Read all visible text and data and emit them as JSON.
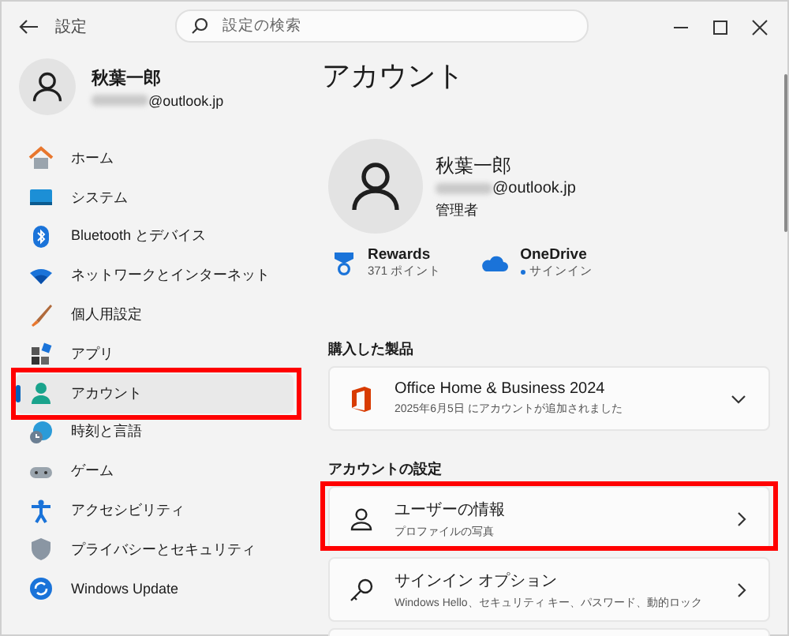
{
  "window": {
    "title": "設定"
  },
  "search": {
    "placeholder": "設定の検索"
  },
  "sidebar": {
    "profile": {
      "name": "秋葉一郎",
      "email": "@outlook.jp"
    },
    "items": [
      {
        "kind": "home",
        "label": "ホーム",
        "selected": false,
        "highlighted": false
      },
      {
        "kind": "system",
        "label": "システム",
        "selected": false,
        "highlighted": false
      },
      {
        "kind": "bluetooth",
        "label": "Bluetooth とデバイス",
        "selected": false,
        "highlighted": false
      },
      {
        "kind": "network",
        "label": "ネットワークとインターネット",
        "selected": false,
        "highlighted": false
      },
      {
        "kind": "personalization",
        "label": "個人用設定",
        "selected": false,
        "highlighted": false
      },
      {
        "kind": "apps",
        "label": "アプリ",
        "selected": false,
        "highlighted": false
      },
      {
        "kind": "accounts",
        "label": "アカウント",
        "selected": true,
        "highlighted": true
      },
      {
        "kind": "time",
        "label": "時刻と言語",
        "selected": false,
        "highlighted": false
      },
      {
        "kind": "gaming",
        "label": "ゲーム",
        "selected": false,
        "highlighted": false
      },
      {
        "kind": "accessibility",
        "label": "アクセシビリティ",
        "selected": false,
        "highlighted": false
      },
      {
        "kind": "privacy",
        "label": "プライバシーとセキュリティ",
        "selected": false,
        "highlighted": false
      },
      {
        "kind": "update",
        "label": "Windows Update",
        "selected": false,
        "highlighted": false
      }
    ]
  },
  "content": {
    "title": "アカウント",
    "profile": {
      "name": "秋葉一郎",
      "email": "@outlook.jp",
      "role": "管理者"
    },
    "services": [
      {
        "kind": "rewards",
        "name": "Rewards",
        "detail": "371 ポイント"
      },
      {
        "kind": "onedrive",
        "name": "OneDrive",
        "detail": "サインイン"
      }
    ],
    "sections": [
      {
        "heading": "購入した製品",
        "cards": [
          {
            "kind": "office",
            "title": "Office Home & Business 2024",
            "subtitle": "2025年6月5日 にアカウントが追加されました",
            "expandable": true,
            "highlighted": false
          }
        ]
      },
      {
        "heading": "アカウントの設定",
        "cards": [
          {
            "kind": "user",
            "title": "ユーザーの情報",
            "subtitle": "プロファイルの写真",
            "expandable": false,
            "highlighted": true
          },
          {
            "kind": "key",
            "title": "サインイン オプション",
            "subtitle": "Windows Hello、セキュリティ キー、パスワード、動的ロック",
            "expandable": false,
            "highlighted": false
          },
          {
            "kind": "blank"
          }
        ]
      }
    ]
  }
}
